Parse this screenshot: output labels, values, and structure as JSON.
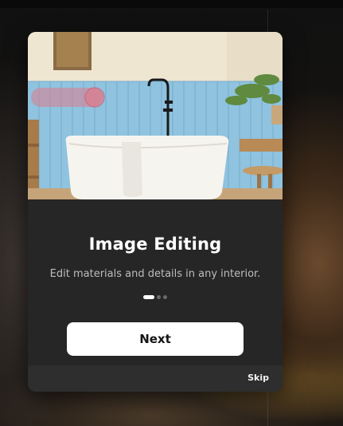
{
  "onboarding": {
    "title": "Image Editing",
    "subtitle": "Edit materials and details in any interior.",
    "pagination": {
      "current": 1,
      "total": 3
    },
    "next_label": "Next",
    "skip_label": "Skip",
    "hero_image": "bathroom-interior-with-freestanding-bathtub"
  },
  "colors": {
    "card_bg": "#262626",
    "footer_bg": "#2e2e2e",
    "button_bg": "#ffffff",
    "button_text": "#151515",
    "tile_blue": "#8fc3df",
    "highlight_pink": "#e07a8a"
  }
}
